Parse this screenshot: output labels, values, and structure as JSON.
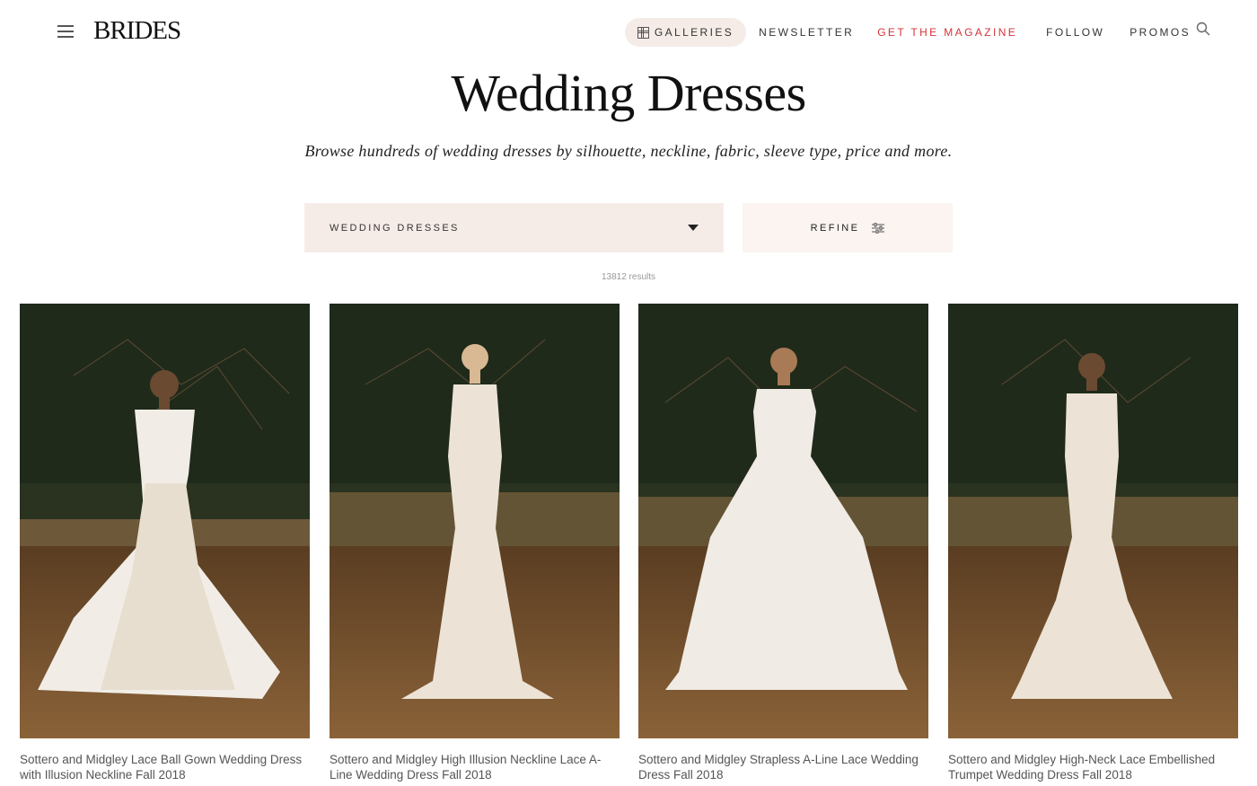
{
  "header": {
    "logo": "BRIDES",
    "nav": {
      "galleries": "Galleries",
      "newsletter": "Newsletter",
      "magazine": "Get the Magazine",
      "follow": "Follow",
      "promos": "Promos"
    }
  },
  "page": {
    "title": "Wedding Dresses",
    "subtitle": "Browse hundreds of wedding dresses by silhouette, neckline, fabric, sleeve type, price and more."
  },
  "filters": {
    "category_selected": "Wedding Dresses",
    "refine_label": "Refine"
  },
  "results_text": "13812 results",
  "cards": [
    {
      "caption": "Sottero and Midgley Lace Ball Gown Wedding Dress with Illusion Neckline Fall 2018"
    },
    {
      "caption": "Sottero and Midgley High Illusion Neckline Lace A-Line Wedding Dress Fall 2018"
    },
    {
      "caption": "Sottero and Midgley Strapless A-Line Lace Wedding Dress Fall 2018"
    },
    {
      "caption": "Sottero and Midgley High-Neck Lace Embellished Trumpet Wedding Dress Fall 2018"
    }
  ],
  "colors": {
    "accent_red": "#d4333a",
    "pill_bg": "#f6ece7",
    "refine_bg": "#fbf4f1"
  }
}
